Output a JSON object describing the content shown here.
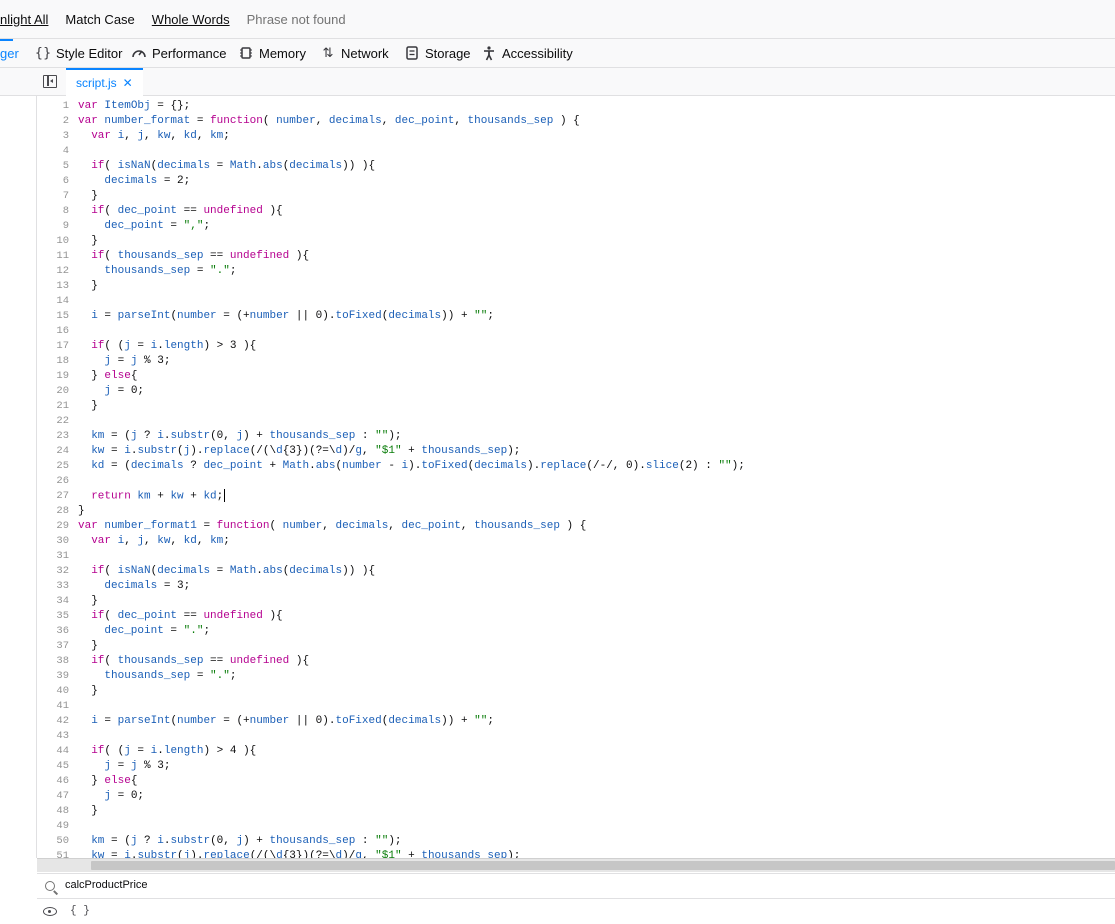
{
  "findbar": {
    "highlight_all": "nlight All",
    "match_case": "Match Case",
    "whole_words": "Whole Words",
    "status": "Phrase not found"
  },
  "toolbar": {
    "tabs": [
      {
        "label": "ger",
        "icon": "debugger-icon",
        "selected": true
      },
      {
        "label": "Style Editor",
        "icon": "braces-icon"
      },
      {
        "label": "Performance",
        "icon": "gauge-icon"
      },
      {
        "label": "Memory",
        "icon": "chip-icon"
      },
      {
        "label": "Network",
        "icon": "arrows-up-down-icon"
      },
      {
        "label": "Storage",
        "icon": "storage-icon"
      },
      {
        "label": "Accessibility",
        "icon": "accessibility-icon"
      }
    ]
  },
  "editor": {
    "file_tab": "script.js",
    "lines": [
      "var ItemObj = {};",
      "var number_format = function( number, decimals, dec_point, thousands_sep ) {",
      "  var i, j, kw, kd, km;",
      "",
      "  if( isNaN(decimals = Math.abs(decimals)) ){",
      "    decimals = 2;",
      "  }",
      "  if( dec_point == undefined ){",
      "    dec_point = \",\";",
      "  }",
      "  if( thousands_sep == undefined ){",
      "    thousands_sep = \".\";",
      "  }",
      "",
      "  i = parseInt(number = (+number || 0).toFixed(decimals)) + \"\";",
      "",
      "  if( (j = i.length) > 3 ){",
      "    j = j % 3;",
      "  } else{",
      "    j = 0;",
      "  }",
      "",
      "  km = (j ? i.substr(0, j) + thousands_sep : \"\");",
      "  kw = i.substr(j).replace(/(\\d{3})(?=\\d)/g, \"$1\" + thousands_sep);",
      "  kd = (decimals ? dec_point + Math.abs(number - i).toFixed(decimals).replace(/-/, 0).slice(2) : \"\");",
      "",
      "  return km + kw + kd;",
      "}",
      "var number_format1 = function( number, decimals, dec_point, thousands_sep ) {",
      "  var i, j, kw, kd, km;",
      "",
      "  if( isNaN(decimals = Math.abs(decimals)) ){",
      "    decimals = 3;",
      "  }",
      "  if( dec_point == undefined ){",
      "    dec_point = \".\";",
      "  }",
      "  if( thousands_sep == undefined ){",
      "    thousands_sep = \".\";",
      "  }",
      "",
      "  i = parseInt(number = (+number || 0).toFixed(decimals)) + \"\";",
      "",
      "  if( (j = i.length) > 4 ){",
      "    j = j % 3;",
      "  } else{",
      "    j = 0;",
      "  }",
      "",
      "  km = (j ? i.substr(0, j) + thousands_sep : \"\");",
      "  kw = i.substr(j).replace(/(\\d{3})(?=\\d)/g, \"$1\" + thousands_sep);",
      ""
    ],
    "cursor_line": 27
  },
  "search": {
    "value": "calcProductPrice"
  },
  "watch": {
    "value": "{ }"
  },
  "colors": {
    "accent": "#0a84ff",
    "keyword": "#b5008f",
    "identifier": "#1b5fb7",
    "string": "#0a7d0a",
    "number": "#0c0c0d"
  }
}
